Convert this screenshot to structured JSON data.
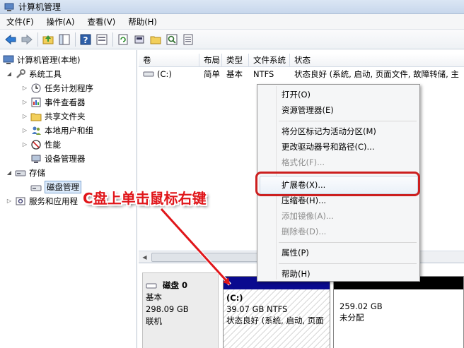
{
  "window": {
    "title": "计算机管理"
  },
  "menu": [
    "文件(F)",
    "操作(A)",
    "查看(V)",
    "帮助(H)"
  ],
  "toolbar": {
    "icons": [
      "back-arrow-icon",
      "forward-arrow-icon",
      "up-folder-icon",
      "show-hide-tree-icon",
      "help-icon",
      "properties-panel-icon",
      "refresh-icon",
      "rescan-disks-icon",
      "open-folder-icon",
      "search-icon",
      "export-list-icon"
    ]
  },
  "tree": {
    "root": "计算机管理(本地)",
    "system_tools": "系统工具",
    "task_scheduler": "任务计划程序",
    "event_viewer": "事件查看器",
    "shared_folders": "共享文件夹",
    "local_users": "本地用户和组",
    "performance": "性能",
    "device_manager": "设备管理器",
    "storage": "存储",
    "disk_management": "磁盘管理",
    "services_apps": "服务和应用程"
  },
  "volume_list": {
    "columns": [
      "卷",
      "布局",
      "类型",
      "文件系统",
      "状态"
    ],
    "rows": [
      {
        "volume": "(C:)",
        "layout": "简单",
        "type": "基本",
        "fs": "NTFS",
        "status": "状态良好 (系统, 启动, 页面文件, 故障转储, 主"
      }
    ]
  },
  "disk": {
    "name": "磁盘 0",
    "type": "基本",
    "size": "298.09 GB",
    "status": "联机",
    "partitions": [
      {
        "label": "(C:)",
        "size": "39.07 GB NTFS",
        "status": "状态良好 (系统, 启动, 页面"
      },
      {
        "size": "259.02 GB",
        "status": "未分配"
      }
    ]
  },
  "context_menu": {
    "open": "打开(O)",
    "explorer": "资源管理器(E)",
    "mark_active": "将分区标记为活动分区(M)",
    "change_letter": "更改驱动器号和路径(C)...",
    "format": "格式化(F)...",
    "extend": "扩展卷(X)...",
    "shrink": "压缩卷(H)...",
    "add_mirror": "添加镜像(A)...",
    "delete": "删除卷(D)...",
    "properties": "属性(P)",
    "help": "帮助(H)"
  },
  "annotation": {
    "text": "C盘上单击鼠标右键"
  },
  "colors": {
    "annotation_red": "#cc1f1f",
    "primary_partition_bar": "#0a0a8f",
    "unallocated_bar": "#000000"
  }
}
